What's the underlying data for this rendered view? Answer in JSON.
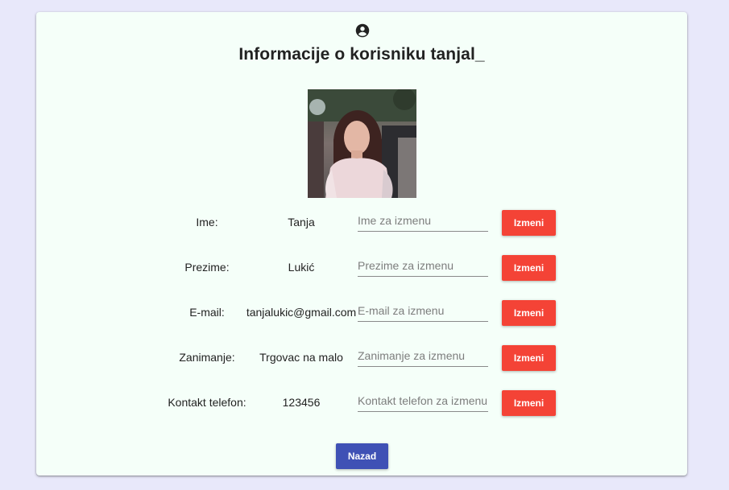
{
  "page": {
    "title": "Informacije o korisniku tanjal_",
    "icon": "account-circle-icon",
    "photo_icon": "profile-photo"
  },
  "fields": [
    {
      "label": "Ime:",
      "value": "Tanja",
      "placeholder": "Ime za izmenu",
      "button": "Izmeni"
    },
    {
      "label": "Prezime:",
      "value": "Lukić",
      "placeholder": "Prezime za izmenu",
      "button": "Izmeni"
    },
    {
      "label": "E-mail:",
      "value": "tanjalukic@gmail.com",
      "placeholder": "E-mail za izmenu",
      "button": "Izmeni"
    },
    {
      "label": "Zanimanje:",
      "value": "Trgovac na malo",
      "placeholder": "Zanimanje za izmenu",
      "button": "Izmeni"
    },
    {
      "label": "Kontakt telefon:",
      "value": "123456",
      "placeholder": "Kontakt telefon za izmenu",
      "button": "Izmeni"
    }
  ],
  "back_button": "Nazad",
  "colors": {
    "background": "#e8e8fa",
    "card": "#f5fff9",
    "edit_button": "#f44336",
    "back_button": "#3f51b5"
  }
}
